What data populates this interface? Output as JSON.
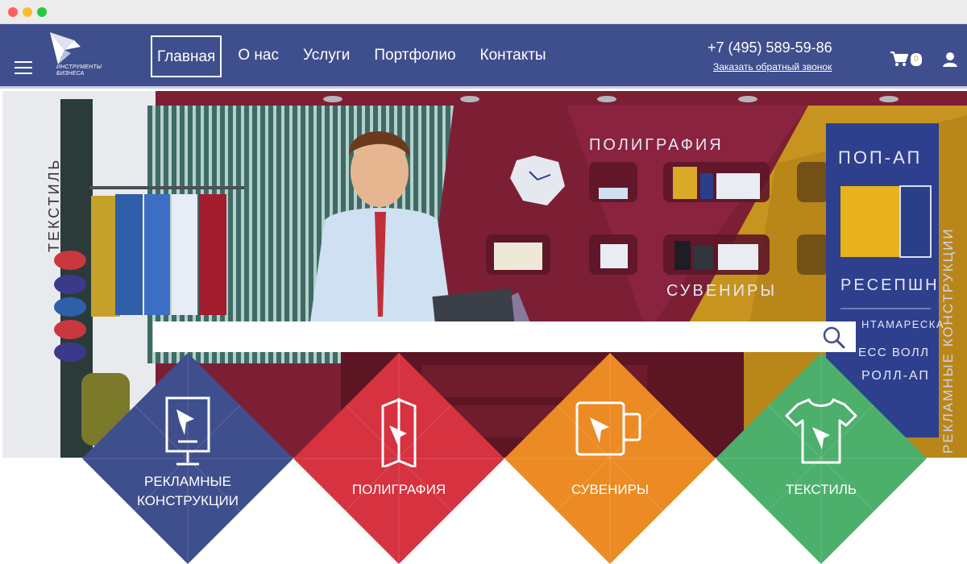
{
  "brand": {
    "logo_text_line1": "ИНСТРУМЕНТЫ",
    "logo_text_line2": "БИЗНЕСА"
  },
  "nav": {
    "items": [
      {
        "label": "Главная",
        "active": true
      },
      {
        "label": "О нас"
      },
      {
        "label": "Услуги"
      },
      {
        "label": "Портфолио"
      },
      {
        "label": "Контакты"
      }
    ]
  },
  "contacts": {
    "phone": "+7 (495) 589-59-86",
    "callback_link": "Заказать обратный звонок"
  },
  "cart": {
    "count": "0",
    "icon": "cart-icon"
  },
  "user": {
    "icon": "user-icon"
  },
  "hero": {
    "words": {
      "textile": "ТЕКСТИЛЬ",
      "polygraphy": "ПОЛИГРАФИЯ",
      "souvenirs": "СУВЕНИРЫ",
      "popup": "ПОП-АП",
      "reception": "РЕСЕПШН",
      "pantamaresca": "НТАМАРЕСКА",
      "press_wall": "ЕСС ВОЛЛ",
      "roll_up": "РОЛЛ-АП",
      "ad_structures": "РЕКЛАМНЫЕ КОНСТРУКЦИИ"
    }
  },
  "search": {
    "placeholder": "",
    "value": "",
    "icon": "search-icon"
  },
  "categories": [
    {
      "label_line1": "РЕКЛАМНЫЕ",
      "label_line2": "КОНСТРУКЦИИ",
      "color": "#3f4e8c",
      "icon": "billboard-icon"
    },
    {
      "label_line1": "ПОЛИГРАФИЯ",
      "label_line2": "",
      "color": "#d6323f",
      "icon": "booklet-icon"
    },
    {
      "label_line1": "СУВЕНИРЫ",
      "label_line2": "",
      "color": "#ec8a24",
      "icon": "mug-icon"
    },
    {
      "label_line1": "ТЕКСТИЛЬ",
      "label_line2": "",
      "color": "#4caf6b",
      "icon": "tshirt-icon"
    }
  ],
  "colors": {
    "header_bg": "#3f4e8c",
    "blue": "#3f4e8c",
    "red": "#d6323f",
    "orange": "#ec8a24",
    "green": "#4caf6b"
  }
}
